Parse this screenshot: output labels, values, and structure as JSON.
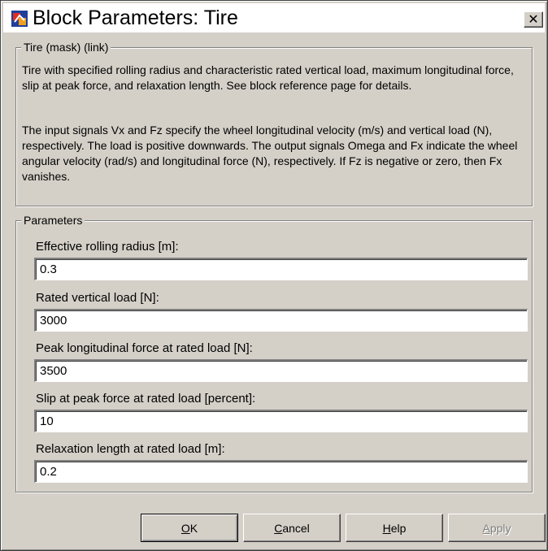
{
  "window": {
    "title": "Block Parameters: Tire",
    "close_glyph": "✕",
    "icon": "simulink-block-icon"
  },
  "description": {
    "group_label": "Tire (mask) (link)",
    "paragraphs": [
      "Tire with specified rolling radius and characteristic rated vertical load, maximum longitudinal force, slip at peak force, and relaxation length. See block reference page for details.",
      "The input signals Vx and Fz specify the wheel longitudinal velocity (m/s) and vertical load (N), respectively. The load is positive downwards. The output signals Omega and Fx indicate the wheel angular velocity (rad/s) and longitudinal force (N), respectively. If Fz is negative or zero, then Fx vanishes."
    ]
  },
  "parameters": {
    "group_label": "Parameters",
    "fields": [
      {
        "label": "Effective rolling radius [m]:",
        "value": "0.3"
      },
      {
        "label": "Rated vertical load [N]:",
        "value": "3000"
      },
      {
        "label": "Peak longitudinal force at rated load [N]:",
        "value": "3500"
      },
      {
        "label": "Slip at peak force at rated load [percent]:",
        "value": "10"
      },
      {
        "label": "Relaxation length at rated load [m]:",
        "value": "0.2"
      }
    ]
  },
  "buttons": {
    "ok": {
      "accel": "O",
      "rest": "K"
    },
    "cancel": {
      "accel": "C",
      "rest": "ancel"
    },
    "help": {
      "accel": "H",
      "rest": "elp"
    },
    "apply": {
      "accel": "A",
      "rest": "pply",
      "enabled": false
    }
  },
  "colors": {
    "dialog_face": "#d4d0c8",
    "titlebar": "#ffffff",
    "text": "#000000",
    "disabled_text": "#808080"
  }
}
